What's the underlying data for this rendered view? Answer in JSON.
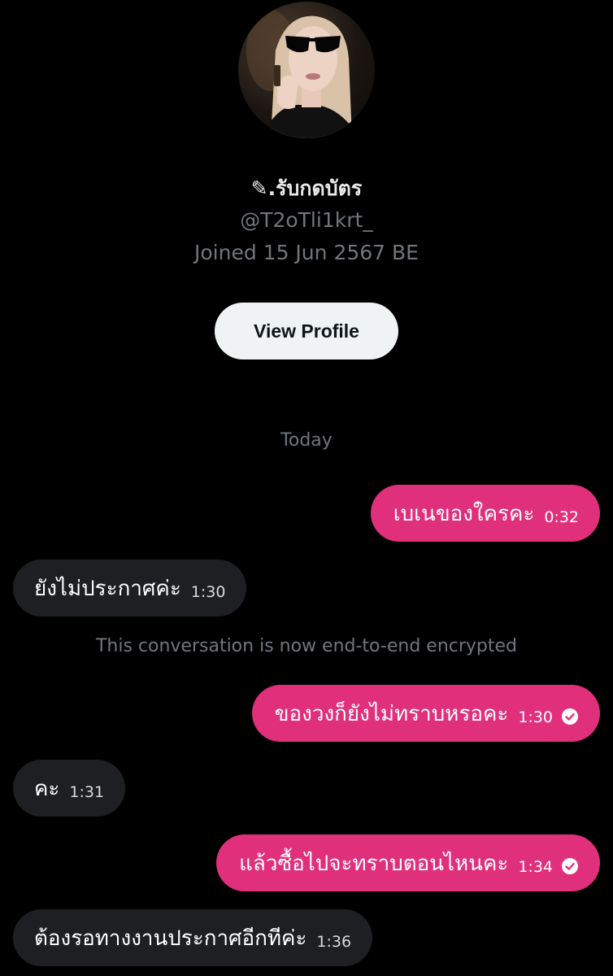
{
  "profile": {
    "display_name": "✎.รับกดบัตร",
    "handle": "@T2oTli1krt_",
    "joined": "Joined 15 Jun 2567 BE",
    "view_profile_label": "View Profile"
  },
  "conversation": {
    "date_separator": "Today",
    "encryption_notice": "This conversation is now end-to-end encrypted",
    "messages": [
      {
        "direction": "outgoing",
        "text": "เบเนของใครคะ",
        "time": "0:32",
        "read_receipt": false
      },
      {
        "direction": "incoming",
        "text": "ยังไม่ประกาศค่ะ",
        "time": "1:30"
      },
      {
        "direction": "outgoing",
        "text": "ของวงก็ยังไม่ทราบหรอคะ",
        "time": "1:30",
        "read_receipt": true
      },
      {
        "direction": "incoming",
        "text": "คะ",
        "time": "1:31"
      },
      {
        "direction": "outgoing",
        "text": "แล้วซื้อไปจะทราบตอนไหนคะ",
        "time": "1:34",
        "read_receipt": true
      },
      {
        "direction": "incoming",
        "text": "ต้องรอทางงานประกาศอีกทีค่ะ",
        "time": "1:36"
      }
    ]
  },
  "colors": {
    "background": "#000000",
    "outgoing_bubble": "#e0307b",
    "incoming_bubble": "#1d1f22",
    "muted_text": "#71767b",
    "button_bg": "#eff3f4"
  },
  "icons": {
    "read_receipt": "check-circle-icon",
    "avatar": "profile-photo"
  }
}
